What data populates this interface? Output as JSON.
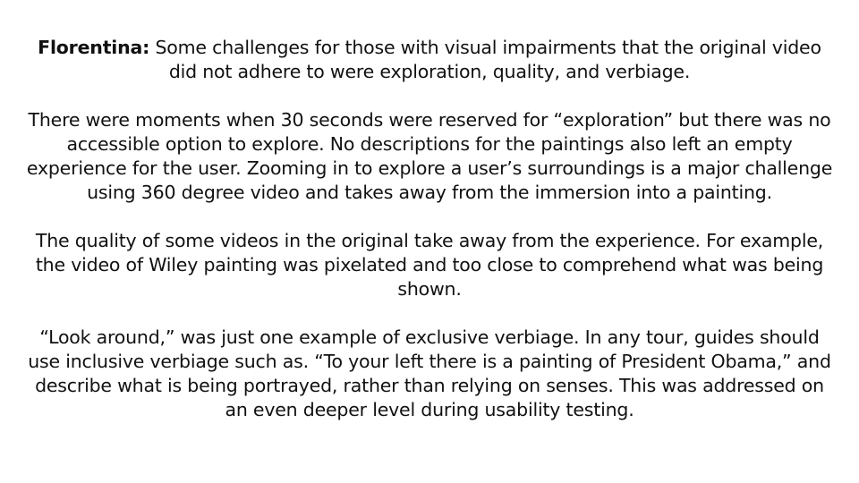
{
  "slide": {
    "speaker": "Florentina:",
    "intro": "Some challenges for those with visual impairments that the original video did not adhere to were exploration, quality, and verbiage.",
    "paragraphs": [
      "There were moments when 30 seconds were reserved for “exploration” but there was no accessible option to explore. No descriptions for the paintings also left an empty experience for the user. Zooming in to explore a user’s surroundings is a major challenge using 360 degree video and takes away from the immersion into a painting.",
      "The quality of some videos in the original take away from the experience. For example, the video of Wiley painting was pixelated and too close to comprehend what was being shown.",
      "“Look around,” was just one example of exclusive verbiage. In any tour, guides should use inclusive verbiage such as. “To your left there is a painting of President Obama,” and describe what is being portrayed, rather than relying on senses. This was addressed on an even deeper level during usability testing."
    ]
  }
}
